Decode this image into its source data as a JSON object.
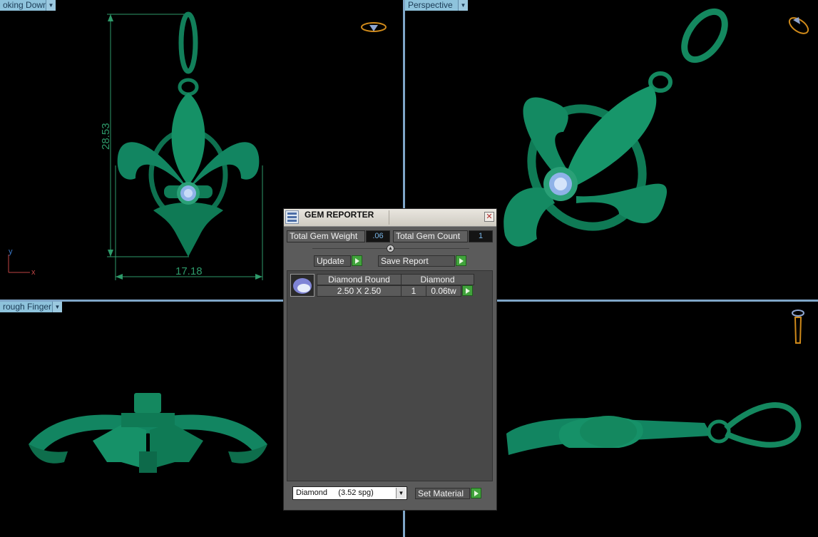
{
  "viewports": {
    "top_left": {
      "label": "oking Down"
    },
    "top_right": {
      "label": "Perspective"
    },
    "bottom_left": {
      "label": "rough Finger"
    }
  },
  "dimensions": {
    "height": "28.53",
    "width": "17.18"
  },
  "axes": {
    "y": "y",
    "x": "x"
  },
  "dialog": {
    "title": "GEM REPORTER",
    "close_glyph": "✕",
    "total_gem_weight_label": "Total Gem Weight",
    "total_gem_weight_value": ".06",
    "total_gem_count_label": "Total Gem Count",
    "total_gem_count_value": "1",
    "update_label": "Update",
    "save_report_label": "Save Report",
    "gem_row": {
      "shape": "Diamond Round",
      "material": "Diamond",
      "size": "2.50 X 2.50",
      "count": "1",
      "weight": "0.06tw"
    },
    "material_select_value": "Diamond     (3.52 spg)",
    "set_material_label": "Set Material"
  },
  "colors": {
    "model": "#0f7a55",
    "divider": "#7fa6c8",
    "gem": "#8fb2e8"
  },
  "icons": [
    "view-cube-icon",
    "gem-icon",
    "play-icon",
    "close-icon",
    "chevron-down-icon"
  ]
}
